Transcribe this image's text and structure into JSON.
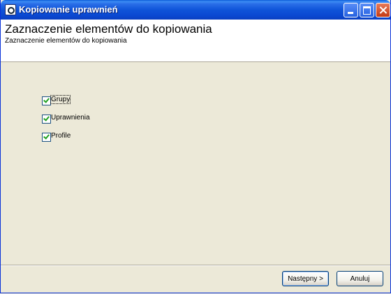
{
  "window": {
    "title": "Kopiowanie uprawnień"
  },
  "header": {
    "title": "Zaznaczenie elementów do kopiowania",
    "subtitle": "Zaznaczenie elementów do kopiowania"
  },
  "options": [
    {
      "label": "Grupy",
      "checked": true
    },
    {
      "label": "Uprawnienia",
      "checked": true
    },
    {
      "label": "Profile",
      "checked": true
    }
  ],
  "buttons": {
    "next": "Następny >",
    "cancel": "Anuluj"
  }
}
